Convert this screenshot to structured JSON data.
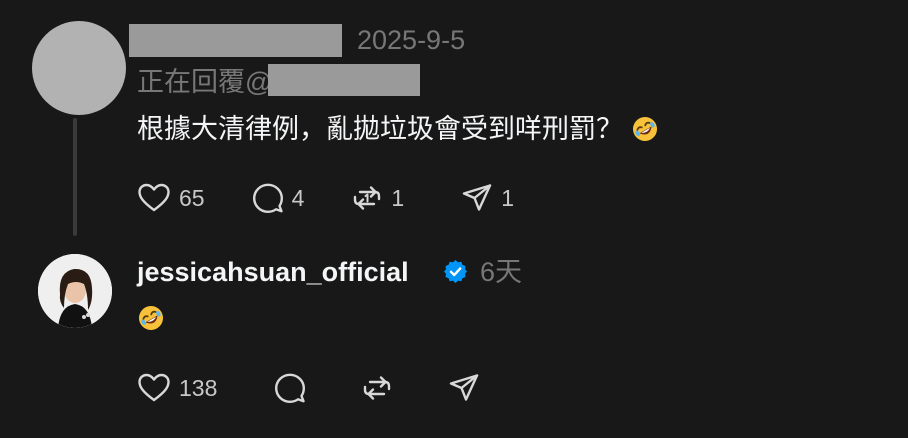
{
  "comment": {
    "date": "2025-9-5",
    "reply_prefix": "正在回覆@",
    "text": "根據大清律例，亂拋垃圾會受到咩刑罰？",
    "emoji_icon": "rolling-on-floor-laughing-emoji",
    "likes": "65",
    "replies": "4",
    "reposts": "1",
    "shares": "1"
  },
  "reply": {
    "username": "jessicahsuan_official",
    "time": "6天",
    "emoji_icon": "rolling-on-floor-laughing-emoji",
    "likes": "138"
  },
  "colors": {
    "background": "#181818",
    "text": "#f3f5f7",
    "muted": "#777777",
    "verified": "#0095f6"
  }
}
